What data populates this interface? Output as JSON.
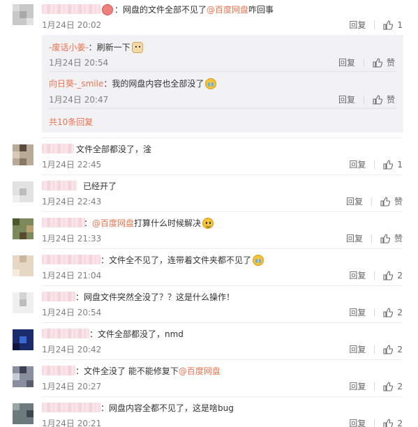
{
  "labels": {
    "reply": "回复",
    "like": "赞"
  },
  "comments": [
    {
      "text": "：网盘的文件全部不见了",
      "mention": "@百度网盘",
      "text_after": " 咋回事",
      "time": "1月24日 20:02",
      "likes": "1",
      "replies_box": {
        "items": [
          {
            "name": "-废话小姜-",
            "text": "：刷新一下",
            "time": "1月24日 20:54",
            "like_label": "赞"
          },
          {
            "name": "向日葵-_smile",
            "text": "：我的网盘内容也全部没了",
            "time": "1月24日 20:47",
            "like_label": "赞"
          }
        ],
        "more": "共10条回复"
      }
    },
    {
      "text": "文件全部都没了，淦",
      "time": "1月24日 22:45",
      "likes": "1"
    },
    {
      "text": "已经开了",
      "time": "1月24日 22:43",
      "likes": "赞"
    },
    {
      "text": "：",
      "mention": "@百度网盘",
      "text_after": " 打算什么时候解决",
      "time": "1月24日 21:33",
      "likes": "赞"
    },
    {
      "text": "：文件全不见了，连带着文件夹都不见了",
      "time": "1月24日 21:04",
      "likes": "2"
    },
    {
      "text": "：网盘文件突然全没了？？这是什么操作！",
      "time": "1月24日 20:54",
      "likes": "2"
    },
    {
      "text": "：文件全部都没了，nmd",
      "time": "1月24日 20:42",
      "likes": "2"
    },
    {
      "text": "：文件全没了 能不能修复下",
      "mention": "@百度网盘",
      "text_after": "",
      "time": "1月24日 20:27",
      "likes": "2"
    },
    {
      "text": "：网盘内容全都不见了，这是啥bug",
      "time": "1月24日 20:21",
      "likes": "2"
    }
  ]
}
